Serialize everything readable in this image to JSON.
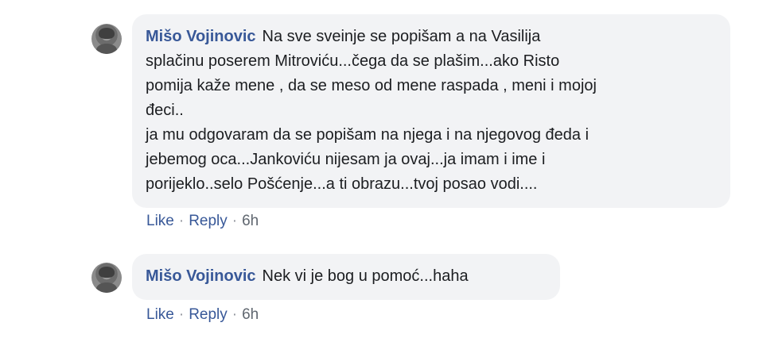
{
  "comments": [
    {
      "author": "Mišo Vojinovic",
      "text": "Na sve sveinje se popišam a na Vasilija\nsplačinu poserem Mitroviću...čega da se plašim...ako Risto\npomija kaže mene , da se meso od mene raspada , meni i mojoj\nđeci..\nja mu odgovaram da se popišam na njega i na njegovog đeda i\njebemog oca...Jankoviću nijesam ja ovaj...ja imam i ime i\nporijeklo..selo Pošćenje...a ti obrazu...tvoj posao vodi....",
      "like_label": "Like",
      "reply_label": "Reply",
      "separator": "·",
      "time": "6h"
    },
    {
      "author": "Mišo Vojinovic",
      "text": "Nek vi je bog u pomoć...haha",
      "like_label": "Like",
      "reply_label": "Reply",
      "separator": "·",
      "time": "6h"
    }
  ]
}
